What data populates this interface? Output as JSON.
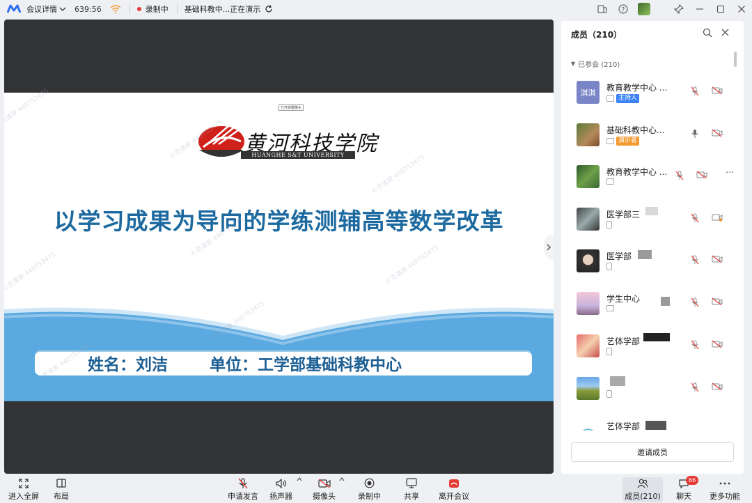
{
  "topbar": {
    "meeting_details": "会议详情",
    "timer": "639:56",
    "recording": "录制中",
    "presenting": "基础科教中...正在演示"
  },
  "slide": {
    "university_name_cn": "黄河科技学院",
    "university_name_en": "HUANGHE S&T UNIVERSITY",
    "title": "以学习成果为导向的学练测辅高等数学改革",
    "name_line": "姓名：刘洁",
    "unit_line": "单位：工学部基础科教中心",
    "watermark": "©灵清泉 440753475",
    "tooltip": "已开启摄像头"
  },
  "panel": {
    "title": "成员（210）",
    "group_label": "已参会 (210)",
    "invite_label": "邀请成员",
    "members": [
      {
        "name": "教育教学中心 ...",
        "tag": "主持人",
        "avatar_text": "淇淇"
      },
      {
        "name": "基础科教中心...",
        "tag": "演示者",
        "avatar_text": ""
      },
      {
        "name": "教育教学中心 ...",
        "tag": "",
        "avatar_text": ""
      },
      {
        "name": "医学部三",
        "tag": "",
        "avatar_text": ""
      },
      {
        "name": "医学部",
        "tag": "",
        "avatar_text": ""
      },
      {
        "name": "学生中心",
        "tag": "",
        "avatar_text": ""
      },
      {
        "name": "艺体学部",
        "tag": "",
        "avatar_text": ""
      },
      {
        "name": "",
        "tag": "",
        "avatar_text": ""
      },
      {
        "name": "艺体学部",
        "tag": "",
        "avatar_text": ""
      }
    ]
  },
  "toolbar": {
    "fullscreen": "进入全屏",
    "layout": "布局",
    "request_speak": "申请发言",
    "speaker": "扬声器",
    "camera": "摄像头",
    "recording": "录制中",
    "share": "共享",
    "leave": "离开会议",
    "members": "成员(210)",
    "chat": "聊天",
    "chat_badge": "66",
    "more": "更多功能"
  },
  "colors": {
    "accent_blue": "#3a82f6",
    "record_red": "#e53935",
    "title_blue": "#1d6aa0",
    "band_blue": "#5aa9e0",
    "presenter_orange": "#f29a2e"
  }
}
